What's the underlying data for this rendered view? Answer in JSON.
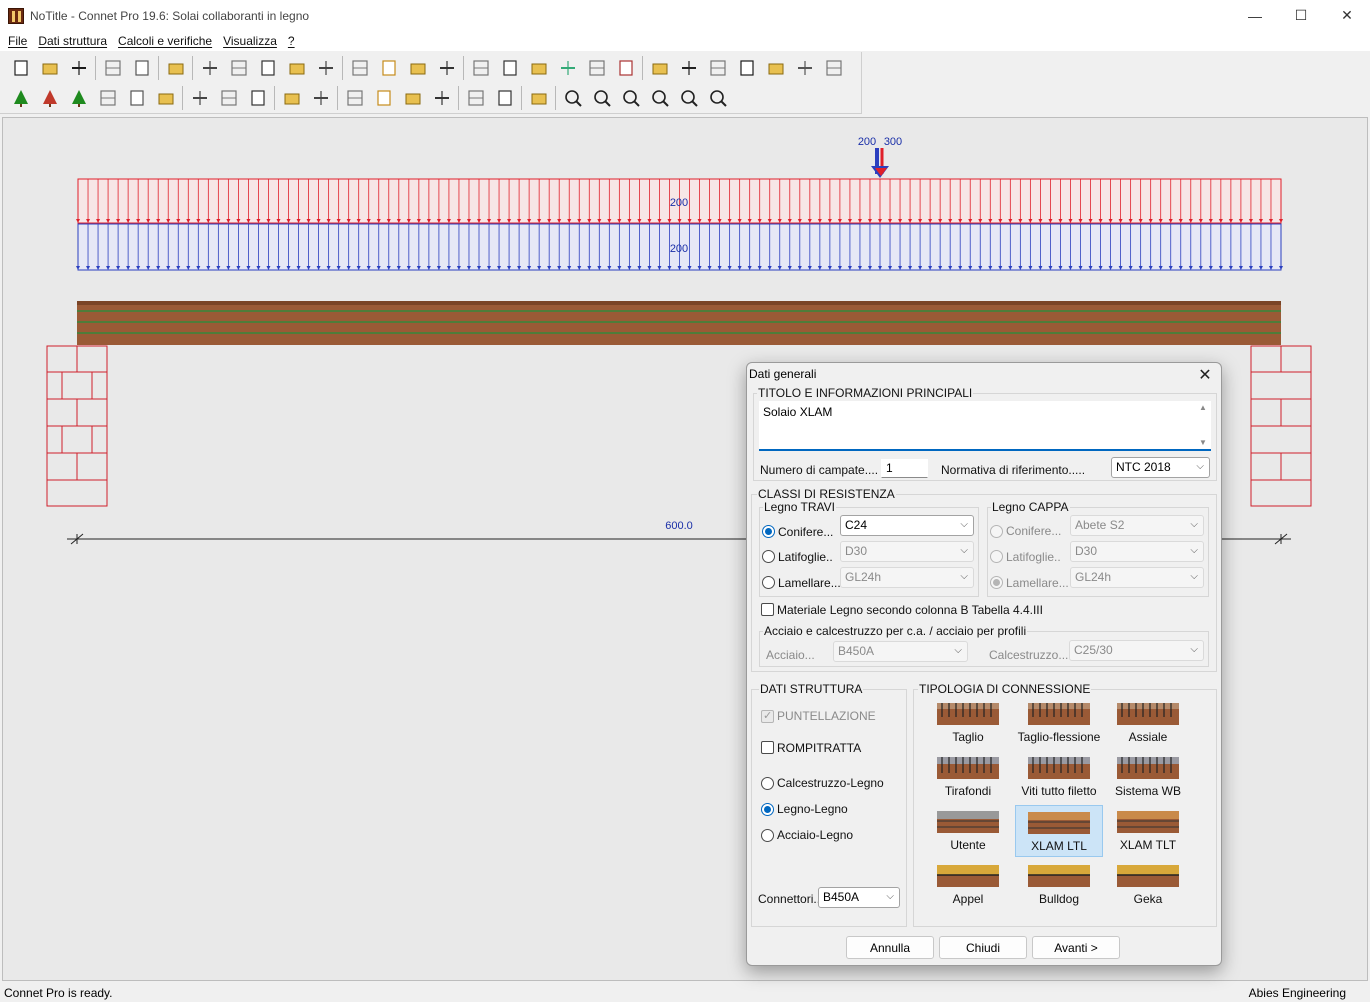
{
  "window": {
    "title": "NoTitle - Connet Pro 19.6: Solai collaboranti in legno",
    "minimize": "—",
    "maximize": "☐",
    "close": "✕"
  },
  "menu": [
    "File",
    "Dati struttura",
    "Calcoli e verifiche",
    "Visualizza",
    "?"
  ],
  "toolbar_row1": [
    "new-file",
    "open-folder",
    "save",
    "print",
    "print-preview",
    "help",
    "layers",
    "route",
    "grid",
    "chart",
    "paint",
    "layers-2",
    "grid-2",
    "arrows",
    "pencil",
    "wand",
    "image",
    "cursor",
    "pencil-2",
    "pencil-3",
    "cog",
    "align-1",
    "align-2",
    "angle",
    "align-3",
    "align-4",
    "align-5",
    "align-6"
  ],
  "toolbar_row2": [
    "tree-green",
    "tree-red",
    "tree-round",
    "column",
    "circle",
    "building",
    "cube",
    "box-red",
    "beam",
    "frame-1",
    "frame-2",
    "frame-3",
    "frame-4",
    "frame-5",
    "frame-6",
    "block",
    "align",
    "i-beam",
    "zoom-fit",
    "zoom-window",
    "zoom-extent",
    "zoom-in",
    "zoom-out",
    "pan"
  ],
  "drawing": {
    "point_load_labels": [
      "200",
      "300"
    ],
    "distributed_load_red": "200",
    "distributed_load_blue": "200",
    "span_length": "600.0"
  },
  "status": {
    "left": "Connet Pro is ready.",
    "right": "Abies Engineering"
  },
  "dialog": {
    "title": "Dati generali",
    "close": "✕",
    "section_title": {
      "label": "TITOLO E INFORMAZIONI PRINCIPALI",
      "text": "Solaio XLAM",
      "scroll_up": "▲",
      "scroll_down": "▼"
    },
    "num_campate_label": "Numero di campate....",
    "num_campate_value": "1",
    "normativa_label": "Normativa di riferimento.....",
    "normativa_value": "NTC 2018",
    "classi": {
      "label": "CLASSI DI RESISTENZA",
      "travi": {
        "label": "Legno TRAVI",
        "options": [
          {
            "label": "Conifere...",
            "value": "C24"
          },
          {
            "label": "Latifoglie..",
            "value": "D30"
          },
          {
            "label": "Lamellare...",
            "value": "GL24h"
          }
        ]
      },
      "cappa": {
        "label": "Legno CAPPA",
        "options": [
          {
            "label": "Conifere...",
            "value": "Abete S2"
          },
          {
            "label": "Latifoglie..",
            "value": "D30"
          },
          {
            "label": "Lamellare...",
            "value": "GL24h"
          }
        ]
      },
      "materiale_check": "Materiale Legno secondo colonna B Tabella 4.4.III",
      "acciaio_group": "Acciaio e calcestruzzo per c.a. / acciaio per profili",
      "acciaio_label": "Acciaio...",
      "acciaio_value": "B450A",
      "cls_label": "Calcestruzzo...",
      "cls_value": "C25/30"
    },
    "dati_struttura": {
      "label": "DATI STRUTTURA",
      "puntellazione": "PUNTELLAZIONE",
      "rompitratta": "ROMPITRATTA",
      "types": [
        "Calcestruzzo-Legno",
        "Legno-Legno",
        "Acciaio-Legno"
      ],
      "connettori_label": "Connettori...",
      "connettori_value": "B450A"
    },
    "tipologia": {
      "label": "TIPOLOGIA DI CONNESSIONE",
      "items": [
        "Taglio",
        "Taglio-flessione",
        "Assiale",
        "Tirafondi",
        "Viti tutto filetto",
        "Sistema WB",
        "Utente",
        "XLAM LTL",
        "XLAM TLT",
        "Appel",
        "Bulldog",
        "Geka"
      ]
    },
    "buttons": {
      "annulla": "Annulla",
      "chiudi": "Chiudi",
      "avanti": "Avanti >"
    }
  },
  "colors": {
    "load_red": "#e0202a",
    "load_blue": "#2b3fbf",
    "wood_brown": "#9a5a36",
    "wood_green": "#4f7c3a",
    "wall_red": "#d0202a",
    "accent": "#0067c0"
  },
  "chevron": "⌵"
}
